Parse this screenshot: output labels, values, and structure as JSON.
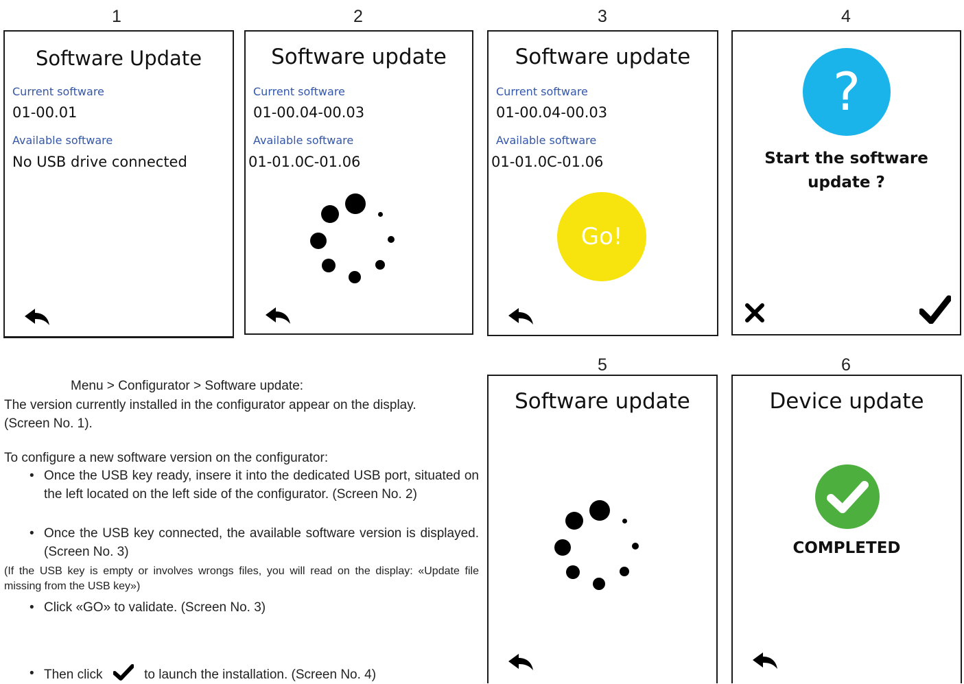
{
  "screens": [
    {
      "number": "1",
      "title": "Software Update",
      "current_label": "Current software",
      "current_value": "01-00.01",
      "available_label": "Available software",
      "available_value": "No USB drive connected"
    },
    {
      "number": "2",
      "title": "Software update",
      "current_label": "Current software",
      "current_value": "01-00.04-00.03",
      "available_label": "Available software",
      "available_value": "01-01.0C-01.06"
    },
    {
      "number": "3",
      "title": "Software update",
      "current_label": "Current software",
      "current_value": "01-00.04-00.03",
      "available_label": "Available software",
      "available_value": "01-01.0C-01.06",
      "go_label": "Go!"
    },
    {
      "number": "4",
      "question_mark": "?",
      "message_line1": "Start the software",
      "message_line2": "update ?"
    },
    {
      "number": "5",
      "title": "Software update"
    },
    {
      "number": "6",
      "title": "Device update",
      "status": "COMPLETED"
    }
  ],
  "colors": {
    "label_blue": "#3457a8",
    "go_yellow": "#f7e30e",
    "question_blue": "#1ab4ea",
    "success_green": "#4caf3e"
  },
  "icons": [
    "back-arrow-icon",
    "loading-spinner-icon",
    "cancel-x-icon",
    "confirm-check-icon",
    "success-check-icon"
  ],
  "instructions": {
    "path": "Menu > Configurator > Software update:",
    "line1": "The version currently installed in the configurator appear on the display.",
    "line2": "(Screen No. 1).",
    "intro": "To configure a new software version on the configurator:",
    "bullet1": "Once the USB key ready, insere it into the dedicated USB port, situated on the left  located on the left side of the configurator. (Screen No. 2)",
    "bullet2": "Once the USB key connected, the available software version is dis­played. (Screen No. 3)",
    "note": "(If the USB key is empty or involves wrongs files, you will read on the display: «Update file missing from the USB key»)",
    "bullet3": "Click «GO» to validate. (Screen No. 3)",
    "bullet4_before": "Then  click",
    "bullet4_after": "to launch the installation. (Screen No. 4)"
  }
}
